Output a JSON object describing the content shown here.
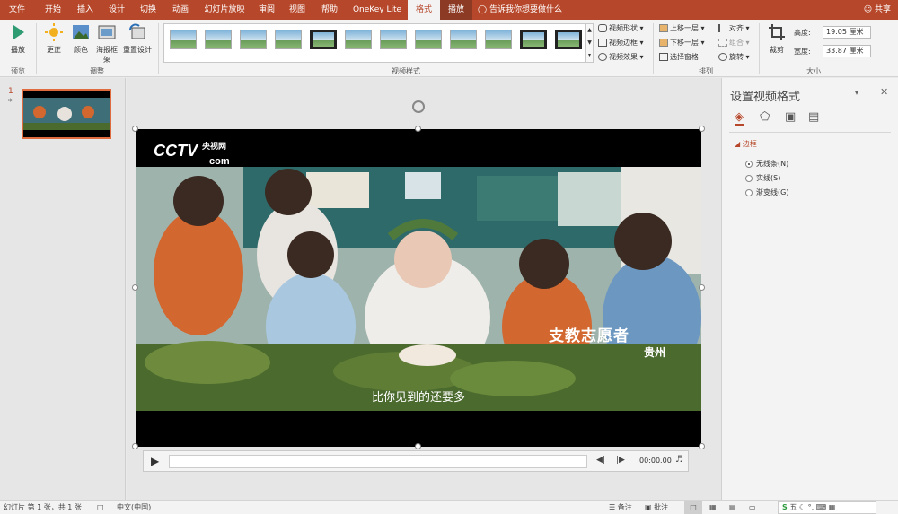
{
  "tabs": [
    {
      "label": "文件",
      "state": "normal"
    },
    {
      "label": "开始",
      "state": "normal"
    },
    {
      "label": "插入",
      "state": "normal"
    },
    {
      "label": "设计",
      "state": "normal"
    },
    {
      "label": "切换",
      "state": "normal"
    },
    {
      "label": "动画",
      "state": "normal"
    },
    {
      "label": "幻灯片放映",
      "state": "normal"
    },
    {
      "label": "审阅",
      "state": "normal"
    },
    {
      "label": "视图",
      "state": "normal"
    },
    {
      "label": "帮助",
      "state": "normal"
    },
    {
      "label": "OneKey Lite",
      "state": "normal"
    },
    {
      "label": "格式",
      "state": "active"
    },
    {
      "label": "播放",
      "state": "contextual"
    }
  ],
  "tell_me": "告诉我你想要做什么",
  "share": "共享",
  "ribbon": {
    "preview": {
      "play": "播放",
      "group": "预览"
    },
    "adjust": {
      "correct": "更正",
      "color": "颜色",
      "poster": "海报框架",
      "reset": "重置设计",
      "group": "调整"
    },
    "styles": {
      "group": "视频样式",
      "shape": "视频形状",
      "border": "视频边框",
      "effects": "视频效果"
    },
    "arrange": {
      "forward": "上移一层",
      "backward": "下移一层",
      "pane": "选择窗格",
      "align": "对齐",
      "group_btn": "组合",
      "rotate": "旋转",
      "group": "排列"
    },
    "size": {
      "crop": "裁剪",
      "height_label": "高度:",
      "height": "19.05 厘米",
      "width_label": "宽度:",
      "width": "33.87 厘米",
      "group": "大小"
    }
  },
  "slides": {
    "number": "1",
    "star": "*"
  },
  "video": {
    "logo": "CCTV",
    "logo_sub": "央视网",
    "logo_com": "com",
    "caption": "比你见到的还要多",
    "title_overlay": "支教志愿者",
    "location": "贵州"
  },
  "player": {
    "time": "00:00.00"
  },
  "format_pane": {
    "title": "设置视频格式",
    "section": "边框",
    "options": [
      {
        "label": "无线条(N)",
        "selected": true
      },
      {
        "label": "实线(S)",
        "selected": false
      },
      {
        "label": "渐变线(G)",
        "selected": false
      }
    ]
  },
  "statusbar": {
    "slide_info": "幻灯片 第 1 张，共 1 张",
    "language": "中文(中国)",
    "notes": "备注",
    "comments": "批注"
  },
  "ime": "五"
}
